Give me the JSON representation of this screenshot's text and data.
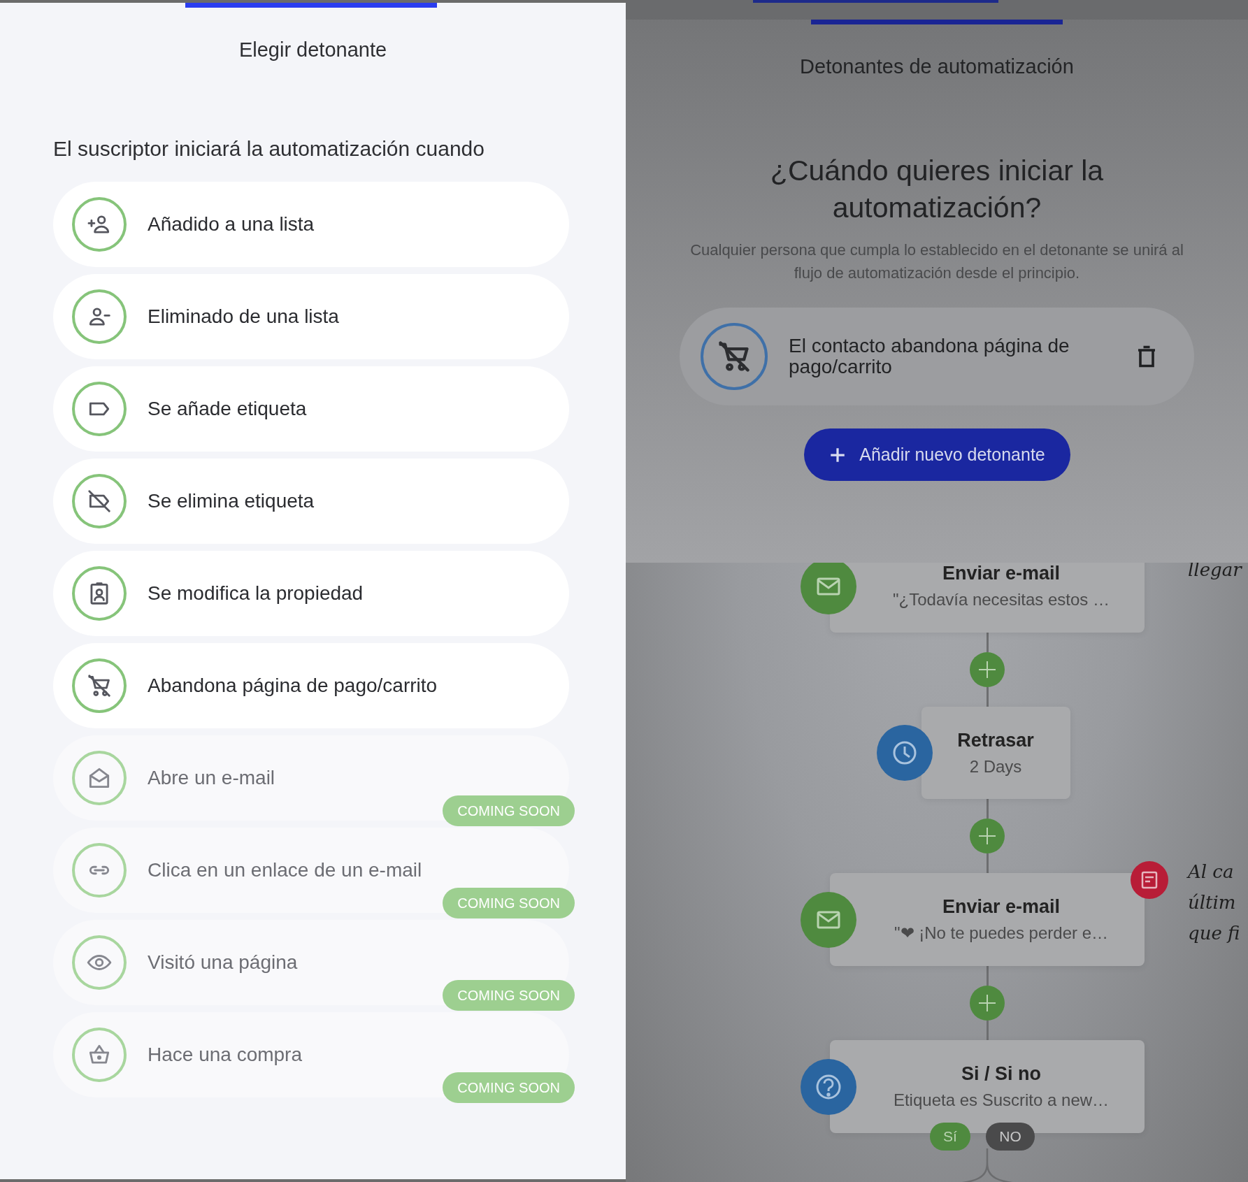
{
  "left_panel": {
    "title": "Elegir detonante",
    "subtitle": "El suscriptor iniciará la automatización cuando",
    "triggers": [
      {
        "label": "Añadido a una lista",
        "disabled": false
      },
      {
        "label": "Eliminado de una lista",
        "disabled": false
      },
      {
        "label": "Se añade etiqueta",
        "disabled": false
      },
      {
        "label": "Se elimina etiqueta",
        "disabled": false
      },
      {
        "label": "Se modifica la propiedad",
        "disabled": false
      },
      {
        "label": "Abandona página de pago/carrito",
        "disabled": false
      },
      {
        "label": "Abre un e-mail",
        "disabled": true,
        "badge": "COMING SOON"
      },
      {
        "label": "Clica en un enlace de un e-mail",
        "disabled": true,
        "badge": "COMING SOON"
      },
      {
        "label": "Visitó una página",
        "disabled": true,
        "badge": "COMING SOON"
      },
      {
        "label": "Hace una compra",
        "disabled": true,
        "badge": "COMING SOON"
      }
    ]
  },
  "right_panel": {
    "title": "Detonantes de automatización",
    "question": "¿Cuándo quieres iniciar la automatización?",
    "description": "Cualquier persona que cumpla lo establecido en el detonante se unirá al flujo de automatización desde el principio.",
    "selected_trigger": {
      "label": "El contacto abandona página de pago/carrito"
    },
    "add_button": "Añadir nuevo detonante",
    "flow": {
      "nodes": [
        {
          "kind": "email",
          "title": "Enviar e-mail",
          "subtitle": "\"¿Todavía necesitas estos …",
          "note": false
        },
        {
          "kind": "delay",
          "title": "Retrasar",
          "subtitle": "2 Days",
          "note": false
        },
        {
          "kind": "email",
          "title": "Enviar e-mail",
          "subtitle": "\"❤ ¡No te puedes perder e…",
          "note": true
        },
        {
          "kind": "condition",
          "title": "Si / Si no",
          "subtitle": "Etiqueta es Suscrito a new…",
          "note": false,
          "yes": "Sí",
          "no": "NO"
        }
      ],
      "notes": [
        "llegar",
        "Al ca",
        "últim",
        "que fi"
      ]
    }
  }
}
